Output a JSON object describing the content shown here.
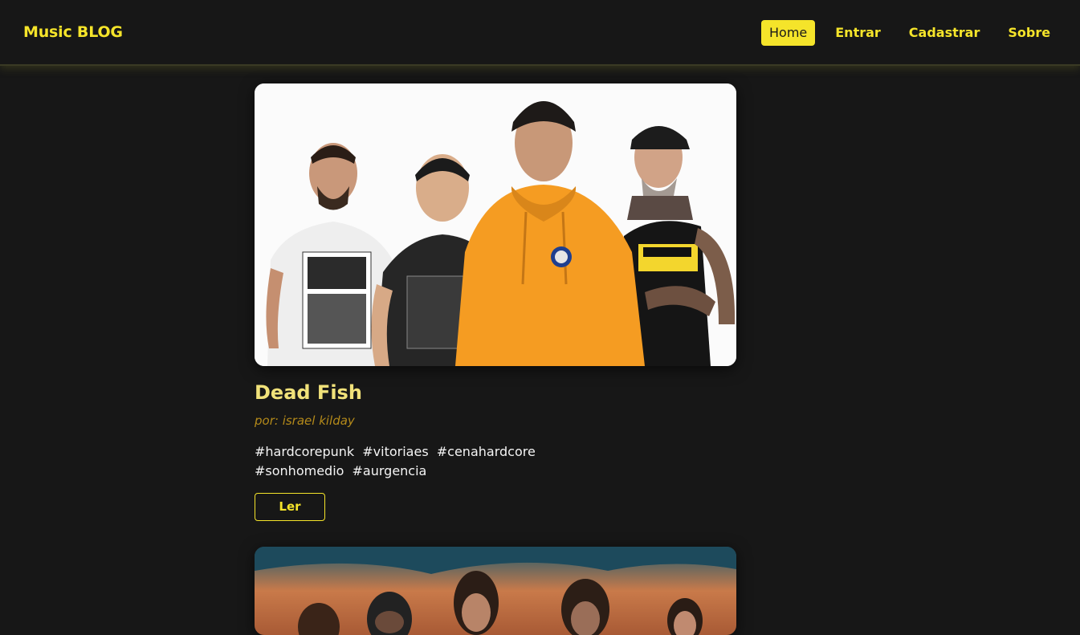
{
  "navbar": {
    "brand": "Music BLOG",
    "links": [
      {
        "label": "Home",
        "active": true
      },
      {
        "label": "Entrar",
        "active": false
      },
      {
        "label": "Cadastrar",
        "active": false
      },
      {
        "label": "Sobre",
        "active": false
      }
    ]
  },
  "posts": [
    {
      "image": "band-photo",
      "title": "Dead Fish",
      "author": "por: israel kilday",
      "tags": [
        "#hardcorepunk",
        "#vitoriaes",
        "#cenahardcore",
        "#sonhomedio",
        "#aurgencia"
      ],
      "button_label": "Ler"
    },
    {
      "image": "band-photo"
    }
  ],
  "colors": {
    "background": "#171717",
    "accent": "#f5e42a",
    "title": "#f1e27a",
    "author": "#b48a1a",
    "tags": "#f4f4f4"
  }
}
